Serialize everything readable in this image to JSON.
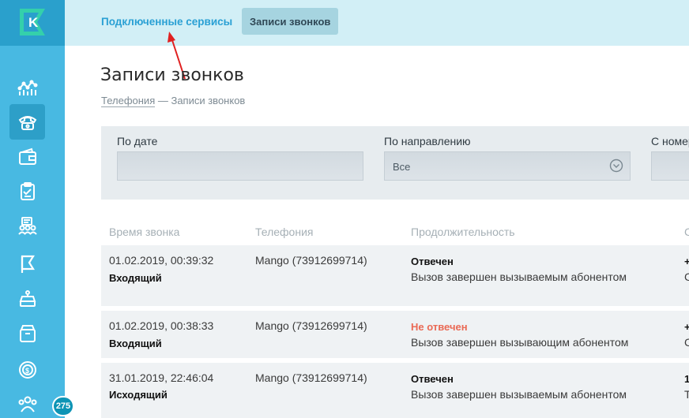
{
  "sidebar": {
    "logo_letter": "K",
    "badge_count": "275",
    "icons": [
      "analytics-icon",
      "phone-icon",
      "wallet-icon",
      "clipboard-icon",
      "users-list-icon",
      "flag-icon",
      "register-icon",
      "archive-box-icon",
      "coin-icon",
      "team-icon"
    ]
  },
  "topbar": {
    "tab_services": "Подключенные сервисы",
    "tab_calls": "Записи звонков"
  },
  "page": {
    "title": "Записи звонков",
    "breadcrumb_link": "Телефония",
    "breadcrumb_sep": " — ",
    "breadcrumb_current": "Записи звонков"
  },
  "filters": {
    "by_date_label": "По дате",
    "by_direction_label": "По направлению",
    "direction_value": "Все",
    "from_number_label": "С номер"
  },
  "table": {
    "headers": {
      "time": "Время звонка",
      "telephony": "Телефония",
      "duration": "Продолжительность",
      "extra": "С"
    },
    "rows": [
      {
        "datetime": "01.02.2019, 00:39:32",
        "direction": "Входящий",
        "telephony": "Mango (73912699714)",
        "status": "Отвечен",
        "status_type": "answered",
        "detail": "Вызов завершен вызываемым абонентом",
        "edge_top": "+",
        "edge_bottom": "С"
      },
      {
        "datetime": "01.02.2019, 00:38:33",
        "direction": "Входящий",
        "telephony": "Mango (73912699714)",
        "status": "Не отвечен",
        "status_type": "missed",
        "detail": "Вызов завершен вызывающим абонентом",
        "edge_top": "+",
        "edge_bottom": "С"
      },
      {
        "datetime": "31.01.2019, 22:46:04",
        "direction": "Исходящий",
        "telephony": "Mango (73912699714)",
        "status": "Отвечен",
        "status_type": "answered",
        "detail": "Вызов завершен вызываемым абонентом",
        "edge_top": "1",
        "edge_bottom": "Т"
      }
    ]
  },
  "colors": {
    "sidebar": "#48b9e2",
    "topbar": "#d2eff6",
    "accent_link": "#2aa0d4",
    "missed": "#ea6a55",
    "annotation_arrow": "#e02020"
  }
}
